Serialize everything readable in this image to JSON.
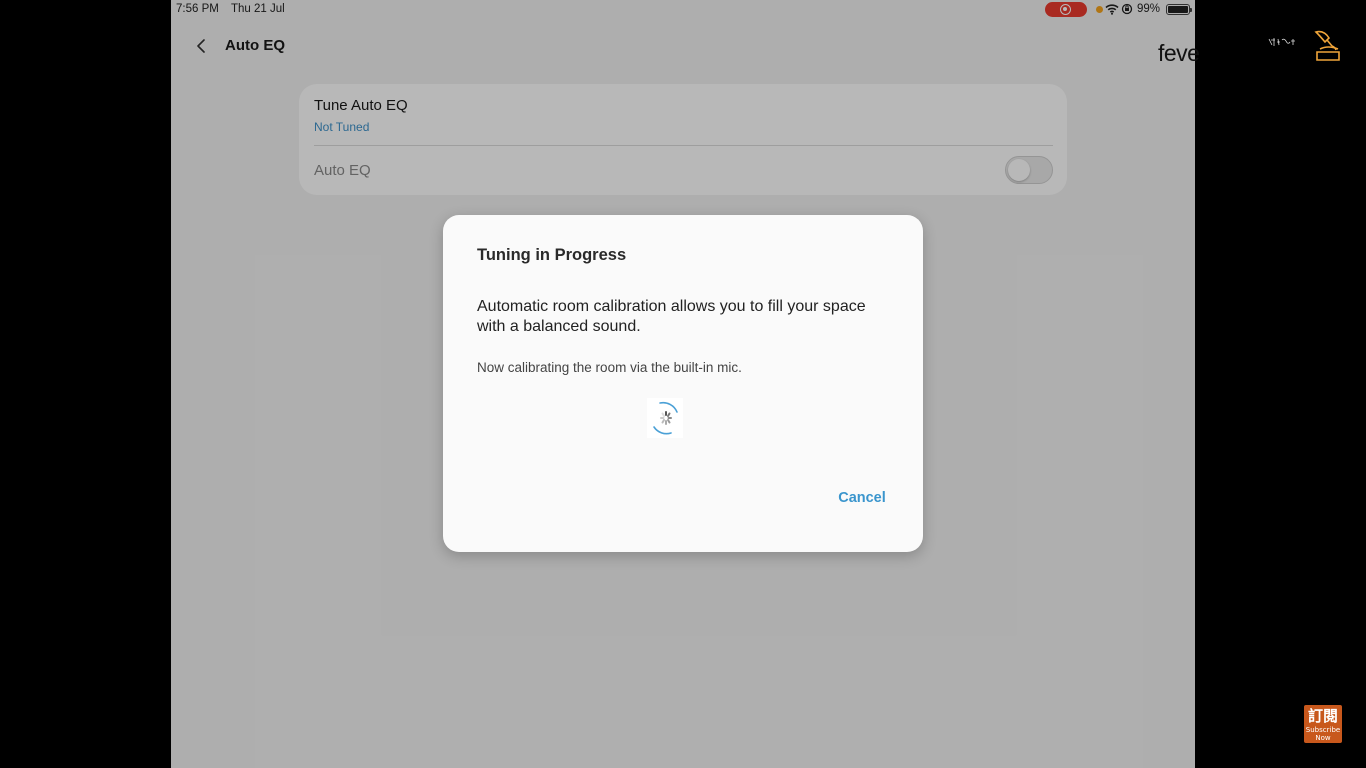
{
  "status_bar": {
    "time": "7:56 PM",
    "date": "Thu 21 Jul",
    "battery": "99%"
  },
  "header": {
    "title": "Auto EQ"
  },
  "settings": {
    "tune_label": "Tune Auto EQ",
    "tune_status": "Not Tuned",
    "auto_eq_label": "Auto EQ",
    "auto_eq_enabled": false
  },
  "dialog": {
    "title": "Tuning in Progress",
    "message": "Automatic room calibration allows you to fill your space with a balanced sound.",
    "sub_message": "Now calibrating the room via the built-in mic.",
    "cancel_label": "Cancel"
  },
  "overlay": {
    "watermark_text": "feve",
    "subscribe_cjk": "訂閱",
    "subscribe_text": "Subscribe Now"
  },
  "colors": {
    "accent": "#3a95cd",
    "status_blue": "#3e91c9",
    "recording_red": "#ea3b2f",
    "subscribe_orange": "#c8581c"
  },
  "icons": {
    "back": "chevron-left-icon",
    "spinner": "loading-spinner-icon",
    "wifi": "wifi-icon",
    "battery": "battery-icon"
  }
}
